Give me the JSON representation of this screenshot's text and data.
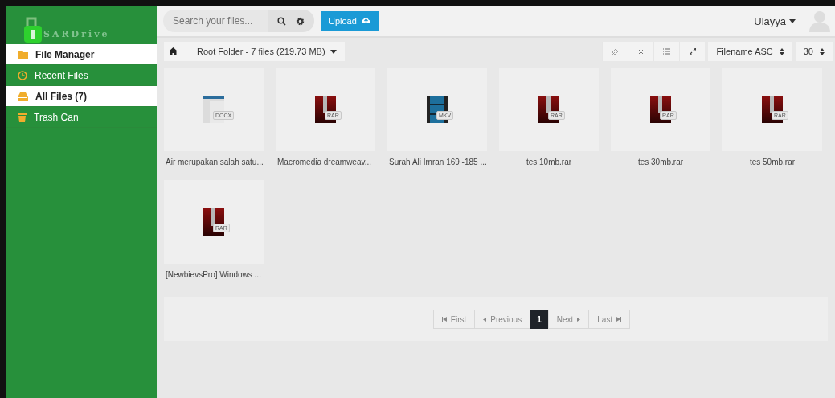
{
  "logo": {
    "text": "SARDrive"
  },
  "sidebar": {
    "items": [
      {
        "label": "File Manager",
        "kind": "folder",
        "selected": true
      },
      {
        "label": "Recent Files",
        "kind": "clock",
        "selected": false
      },
      {
        "label": "All Files (7)",
        "kind": "drive",
        "selected": true
      },
      {
        "label": "Trash Can",
        "kind": "trash",
        "selected": false
      }
    ]
  },
  "topbar": {
    "search": {
      "placeholder": "Search your files..."
    },
    "upload_button": "Upload",
    "user": "Ulayya"
  },
  "breadcrumb": {
    "label": "Root Folder - 7 files (219.73 MB)"
  },
  "toolbar": {
    "sort": "Filename ASC",
    "per_page": "30"
  },
  "files": [
    {
      "name": "Air merupakan salah satu...",
      "kind": "docx",
      "badge": "DOCX"
    },
    {
      "name": "Macromedia dreamweav...",
      "kind": "rar",
      "badge": "RAR"
    },
    {
      "name": "Surah Ali Imran 169 -185 ...",
      "kind": "mkv",
      "badge": "MKV"
    },
    {
      "name": "tes 10mb.rar",
      "kind": "rar",
      "badge": "RAR"
    },
    {
      "name": "tes 30mb.rar",
      "kind": "rar",
      "badge": "RAR"
    },
    {
      "name": "tes 50mb.rar",
      "kind": "rar",
      "badge": "RAR"
    },
    {
      "name": "[NewbievsPro] Windows ...",
      "kind": "rar",
      "badge": "RAR"
    }
  ],
  "pagination": [
    {
      "label": "First",
      "kind": "first",
      "selected": false
    },
    {
      "label": "Previous",
      "kind": "prev",
      "selected": false
    },
    {
      "label": "1",
      "kind": "page",
      "selected": true
    },
    {
      "label": "Next",
      "kind": "next",
      "selected": false
    },
    {
      "label": "Last",
      "kind": "last",
      "selected": false
    }
  ]
}
